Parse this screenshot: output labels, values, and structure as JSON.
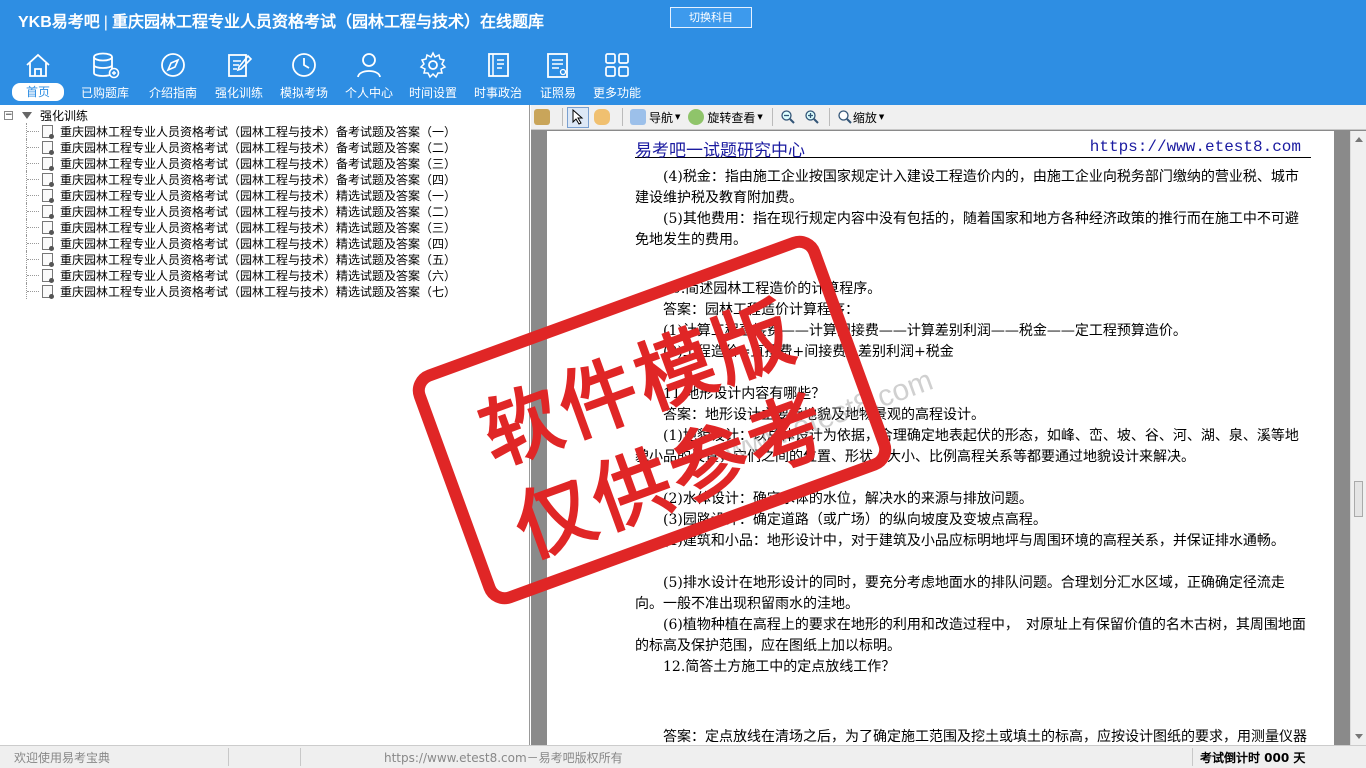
{
  "header": {
    "logo": "YKB易考吧",
    "title": "重庆园林工程专业人员资格考试（园林工程与技术）在线题库",
    "switch_button": "切换科目"
  },
  "nav": [
    {
      "label": "首页",
      "icon": "home-icon",
      "active": true
    },
    {
      "label": "已购题库",
      "icon": "database-icon"
    },
    {
      "label": "介绍指南",
      "icon": "compass-icon"
    },
    {
      "label": "强化训练",
      "icon": "edit-icon"
    },
    {
      "label": "模拟考场",
      "icon": "clock-icon"
    },
    {
      "label": "个人中心",
      "icon": "user-icon"
    },
    {
      "label": "时间设置",
      "icon": "gear-icon"
    },
    {
      "label": "时事政治",
      "icon": "book-icon"
    },
    {
      "label": "证照易",
      "icon": "certificate-icon"
    },
    {
      "label": "更多功能",
      "icon": "grid-icon"
    }
  ],
  "tree": {
    "root": "强化训练",
    "items": [
      "重庆园林工程专业人员资格考试（园林工程与技术）备考试题及答案（一）",
      "重庆园林工程专业人员资格考试（园林工程与技术）备考试题及答案（二）",
      "重庆园林工程专业人员资格考试（园林工程与技术）备考试题及答案（三）",
      "重庆园林工程专业人员资格考试（园林工程与技术）备考试题及答案（四）",
      "重庆园林工程专业人员资格考试（园林工程与技术）精选试题及答案（一）",
      "重庆园林工程专业人员资格考试（园林工程与技术）精选试题及答案（二）",
      "重庆园林工程专业人员资格考试（园林工程与技术）精选试题及答案（三）",
      "重庆园林工程专业人员资格考试（园林工程与技术）精选试题及答案（四）",
      "重庆园林工程专业人员资格考试（园林工程与技术）精选试题及答案（五）",
      "重庆园林工程专业人员资格考试（园林工程与技术）精选试题及答案（六）",
      "重庆园林工程专业人员资格考试（园林工程与技术）精选试题及答案（七）"
    ]
  },
  "toolbar": {
    "nav_label": "导航",
    "rotate_label": "旋转查看",
    "zoom_label": "缩放"
  },
  "document": {
    "header_left": "易考吧一试题研究中心",
    "header_right": "https://www.etest8.com",
    "paragraphs": [
      "　　(4)税金：指由施工企业按国家规定计入建设工程造价内的，由施工企业向税务部门缴纳的营业税、城市建设维护税及教育附加费。",
      "　　(5)其他费用：指在现行规定内容中没有包括的，随着国家和地方各种经济政策的推行而在施工中不可避免地发生的费用。",
      "　　10.简述园林工程造价的计算程序。",
      "　　答案：园林工程造价计算程序：",
      "　　(1)计算工程直接费——计算间接费——计算差别利润——税金——定工程预算造价。",
      "　　(2)工程造价=直接费+间接费+差别利润+税金",
      "　　11.地形设计内容有哪些？",
      "　　答案：地形设计主要指地貌及地物景观的高程设计。",
      "　　(1)地貌设计：以总体设计为依据，合理确定地表起伏的形态，如峰、峦、坡、谷、河、湖、泉、溪等地貌小品的设置，它们之间的位置、形状、大小、比例高程关系等都要通过地貌设计来解决。",
      "　　(2)水体设计：确定水体的水位，解决水的来源与排放问题。",
      "　　(3)园路设计：确定道路（或广场）的纵向坡度及变坡点高程。",
      "　　(4)建筑和小品：地形设计中，对于建筑及小品应标明地坪与周围环境的高程关系，并保证排水通畅。",
      "　　(5)排水设计在地形设计的同时，要充分考虑地面水的排队问题。合理划分汇水区域，正确确定径流走向。一般不准出现积留雨水的洼地。",
      "　　(6)植物种植在高程上的要求在地形的利用和改造过程中，　对原址上有保留价值的名木古树，其周围地面的标高及保护范围，应在图纸上加以标明。",
      "　　12.简答土方施工中的定点放线工作？",
      "　　答案：定点放线在清场之后，为了确定施工范围及挖土或填土的标高，应按设计图纸的要求，用测量仪器在施工现场进行定点放线工作，这一步很重要，为使施工充分表达设计意图，测设时尽量精确。"
    ]
  },
  "stamp": {
    "line1": "软件模版",
    "line2": "仅供参考",
    "watermark": "www.etest8.com"
  },
  "status": {
    "left": "欢迎使用易考宝典",
    "center": "https://www.etest8.com－易考吧版权所有",
    "right": "考试倒计时 000 天"
  },
  "colors": {
    "header_bg": "#2e8ee3",
    "stamp_red": "#e02626",
    "doc_header_blue": "#1a1aa0"
  }
}
